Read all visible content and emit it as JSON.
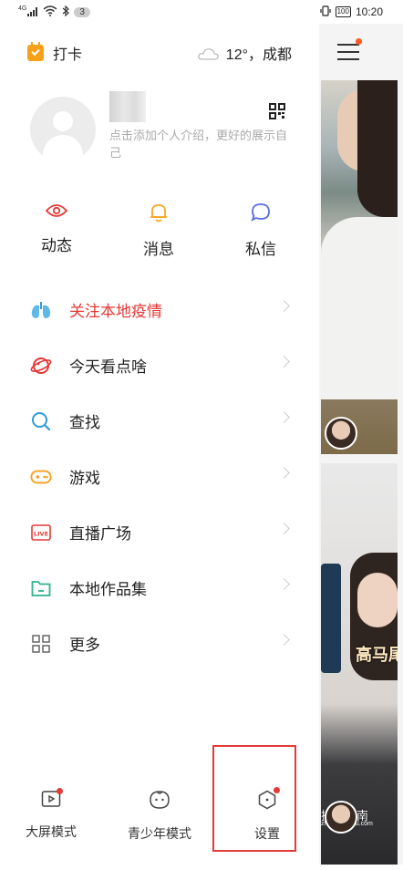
{
  "status_bar": {
    "network": "4G",
    "notification_count": "3",
    "battery": "100",
    "time": "10:20"
  },
  "header": {
    "checkin_label": "打卡",
    "weather": "12°，成都"
  },
  "profile": {
    "intro_placeholder": "点击添加个人介绍，更好的展示自己"
  },
  "quick_actions": [
    {
      "label": "动态",
      "icon": "eye-icon",
      "color": "#e53935"
    },
    {
      "label": "消息",
      "icon": "bell-icon",
      "color": "#f5a623"
    },
    {
      "label": "私信",
      "icon": "chat-bubble-icon",
      "color": "#5b6ee1"
    }
  ],
  "menu": [
    {
      "label": "关注本地疫情",
      "icon": "lungs-icon",
      "highlight": true,
      "color": "#e53935"
    },
    {
      "label": "今天看点啥",
      "icon": "planet-icon"
    },
    {
      "label": "查找",
      "icon": "search-icon"
    },
    {
      "label": "游戏",
      "icon": "gamepad-icon"
    },
    {
      "label": "直播广场",
      "icon": "live-icon"
    },
    {
      "label": "本地作品集",
      "icon": "folder-icon"
    },
    {
      "label": "更多",
      "icon": "grid-icon"
    }
  ],
  "bottom_bar": [
    {
      "label": "大屏模式",
      "icon": "big-screen-icon"
    },
    {
      "label": "青少年模式",
      "icon": "teen-face-icon"
    },
    {
      "label": "设置",
      "icon": "settings-hexagon-icon"
    }
  ],
  "feed": {
    "caption": "高马尾",
    "watermark": "搜狗指南",
    "watermark_sub": "zhinan.sogou.com"
  },
  "colors": {
    "accent_red": "#e53935",
    "accent_orange": "#f7a11a",
    "accent_blue": "#2f9bd9",
    "accent_green": "#2db38c"
  }
}
